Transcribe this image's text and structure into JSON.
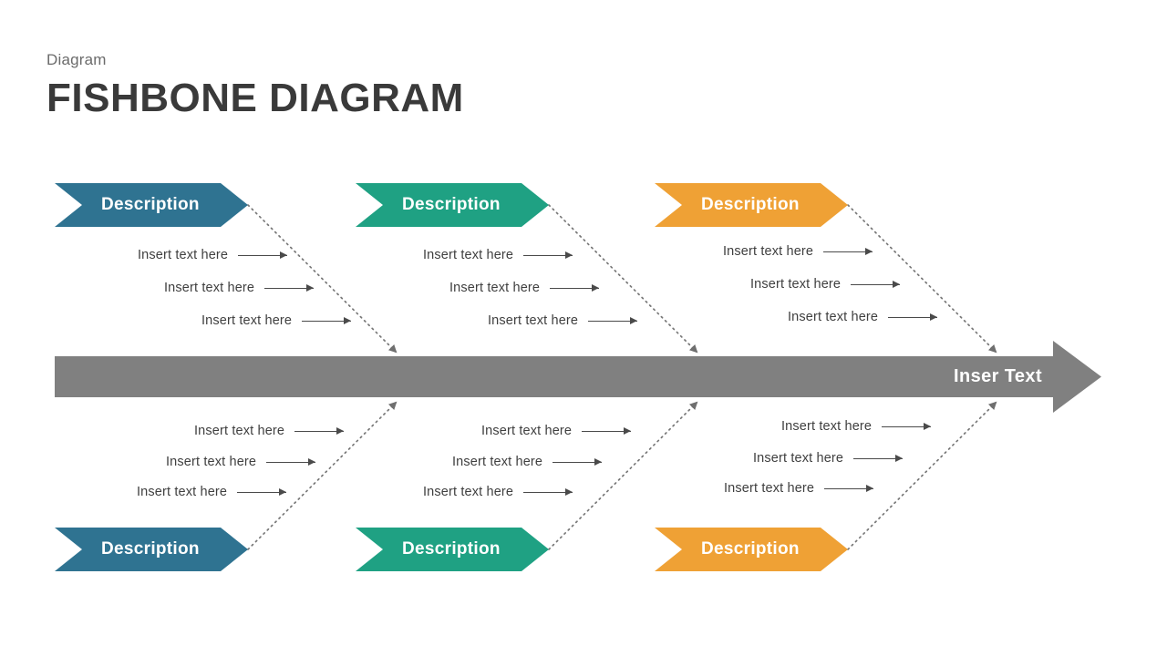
{
  "header": {
    "subtitle": "Diagram",
    "title": "FISHBONE DIAGRAM"
  },
  "colors": {
    "blue": "#2F7391",
    "green": "#1FA183",
    "orange": "#EFA135",
    "spine": "#808080",
    "text": "#3f3f3f",
    "title": "#3a3a3a",
    "subtitle": "#6b6b6b",
    "banner_label": "#ffffff",
    "background": "#ffffff",
    "dotted": "#777777"
  },
  "spine": {
    "label": "Inser Text"
  },
  "branches": {
    "top": [
      {
        "id": "top-blue",
        "color_key": "blue",
        "banner_label": "Description",
        "causes": [
          {
            "text": "Insert text here"
          },
          {
            "text": "Insert text here"
          },
          {
            "text": "Insert text here"
          }
        ]
      },
      {
        "id": "top-green",
        "color_key": "green",
        "banner_label": "Description",
        "causes": [
          {
            "text": "Insert text here"
          },
          {
            "text": "Insert text here"
          },
          {
            "text": "Insert text here"
          }
        ]
      },
      {
        "id": "top-orange",
        "color_key": "orange",
        "banner_label": "Description",
        "causes": [
          {
            "text": "Insert text here"
          },
          {
            "text": "Insert text here"
          },
          {
            "text": "Insert text here"
          }
        ]
      }
    ],
    "bottom": [
      {
        "id": "bottom-blue",
        "color_key": "blue",
        "banner_label": "Description",
        "causes": [
          {
            "text": "Insert text here"
          },
          {
            "text": "Insert text here"
          },
          {
            "text": "Insert text here"
          }
        ]
      },
      {
        "id": "bottom-green",
        "color_key": "green",
        "banner_label": "Description",
        "causes": [
          {
            "text": "Insert text here"
          },
          {
            "text": "Insert text here"
          },
          {
            "text": "Insert text here"
          }
        ]
      },
      {
        "id": "bottom-orange",
        "color_key": "orange",
        "banner_label": "Description",
        "causes": [
          {
            "text": "Insert text here"
          },
          {
            "text": "Insert text here"
          },
          {
            "text": "Insert text here"
          }
        ]
      }
    ]
  }
}
